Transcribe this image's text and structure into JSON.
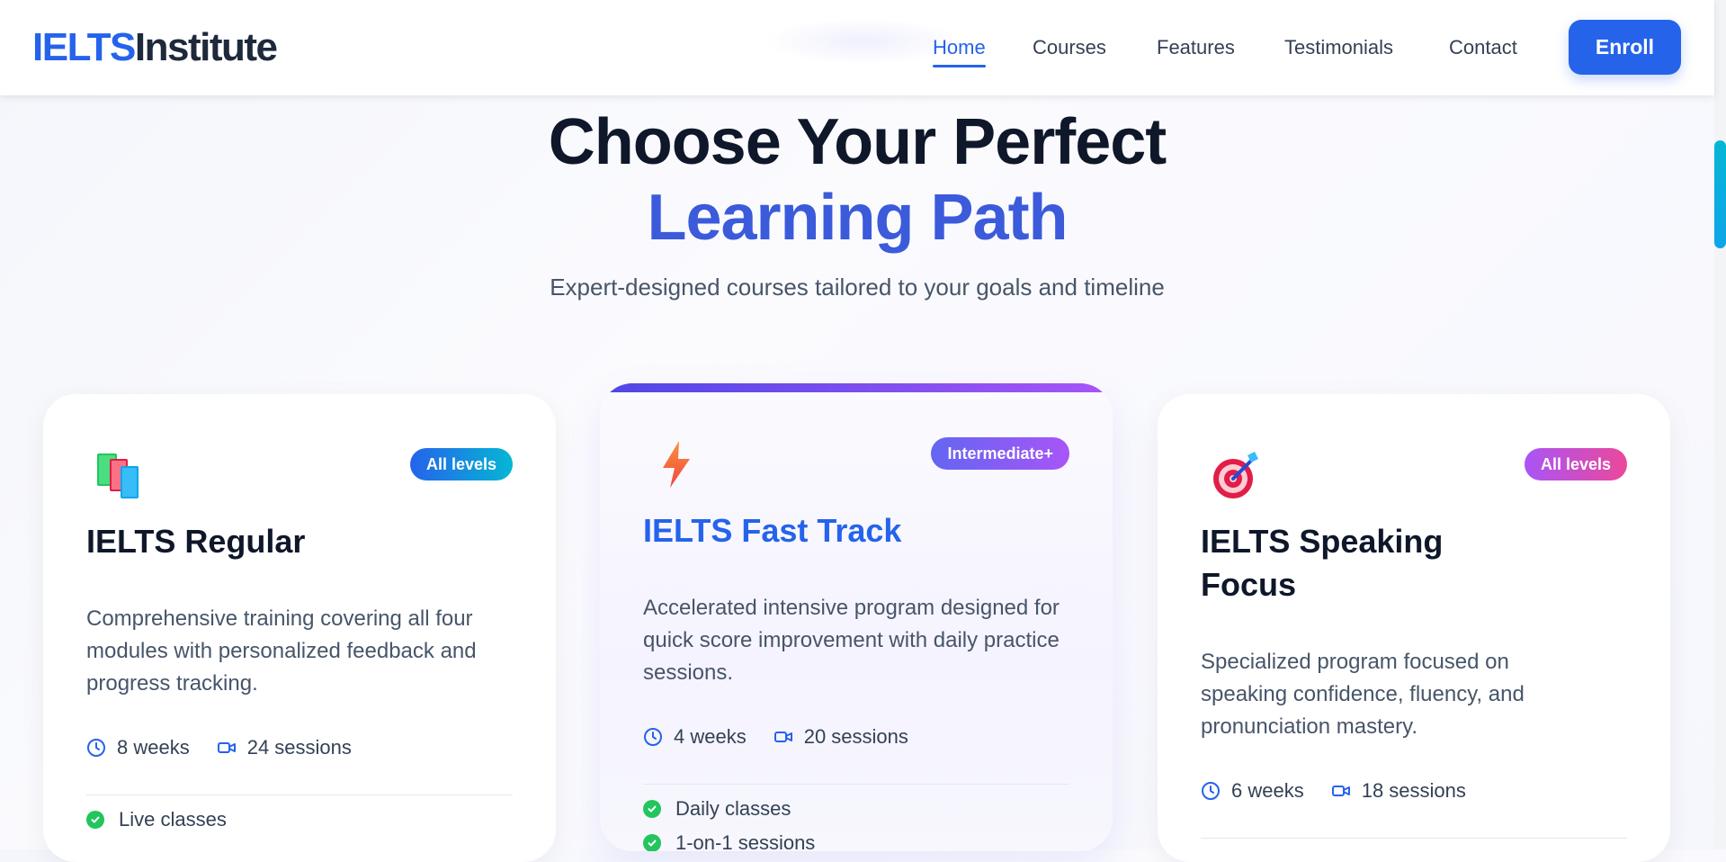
{
  "header": {
    "logo_part1": "IELTS",
    "logo_part2": "Institute",
    "nav": [
      "Home",
      "Courses",
      "Features",
      "Testimonials",
      "Contact"
    ],
    "active_nav": "Home",
    "enroll_label": "Enroll"
  },
  "hero": {
    "title_line1": "Choose Your Perfect",
    "title_line2": "Learning Path",
    "subtitle": "Expert-designed courses tailored to your goals and timeline"
  },
  "cards": [
    {
      "icon": "books-icon",
      "badge": "All levels",
      "title": "IELTS Regular",
      "description": "Comprehensive training covering all four modules with personalized feedback and progress tracking.",
      "duration": "8 weeks",
      "sessions": "24 sessions",
      "features": [
        "Live classes"
      ]
    },
    {
      "icon": "lightning-icon",
      "badge": "Intermediate+",
      "title": "IELTS Fast Track",
      "description": "Accelerated intensive program designed for quick score improvement with daily practice sessions.",
      "duration": "4 weeks",
      "sessions": "20 sessions",
      "features": [
        "Daily classes",
        "1-on-1 sessions"
      ]
    },
    {
      "icon": "target-icon",
      "badge": "All levels",
      "title": "IELTS Speaking Focus",
      "description": "Specialized program focused on speaking confidence, fluency, and pronunciation mastery.",
      "duration": "6 weeks",
      "sessions": "18 sessions",
      "features": []
    }
  ],
  "colors": {
    "primary": "#2563eb",
    "heading": "#0f172a",
    "accent_gradient_start": "#4f46e5",
    "accent_gradient_end": "#a855f7",
    "check": "#22c55e"
  }
}
